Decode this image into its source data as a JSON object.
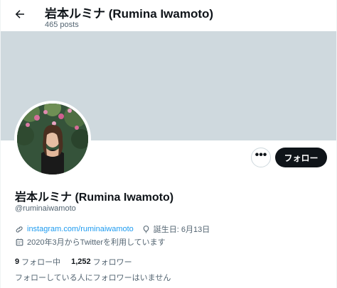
{
  "header": {
    "title": "岩本ルミナ (Rumina Iwamoto)",
    "post_count": "465 posts"
  },
  "profile": {
    "display_name": "岩本ルミナ (Rumina Iwamoto)",
    "handle": "@ruminaiwamoto",
    "website": "instagram.com/ruminaiwamoto",
    "birthday": "誕生日: 6月13日",
    "joined": "2020年3月からTwitterを利用しています",
    "following_count": "9",
    "following_label": "フォロー中",
    "followers_count": "1,252",
    "followers_label": "フォロワー",
    "followers_you_know": "フォローしている人にフォロワーはいません"
  },
  "actions": {
    "follow_label": "フォロー",
    "more_label": "•••"
  },
  "icons": {
    "back": "arrow-left-icon",
    "link": "link-icon",
    "birthday": "balloon-icon",
    "joined": "calendar-icon"
  },
  "colors": {
    "banner": "#cfd9de",
    "link": "#1d9bf0",
    "follow_button": "#0f1419",
    "secondary_text": "#536471"
  }
}
